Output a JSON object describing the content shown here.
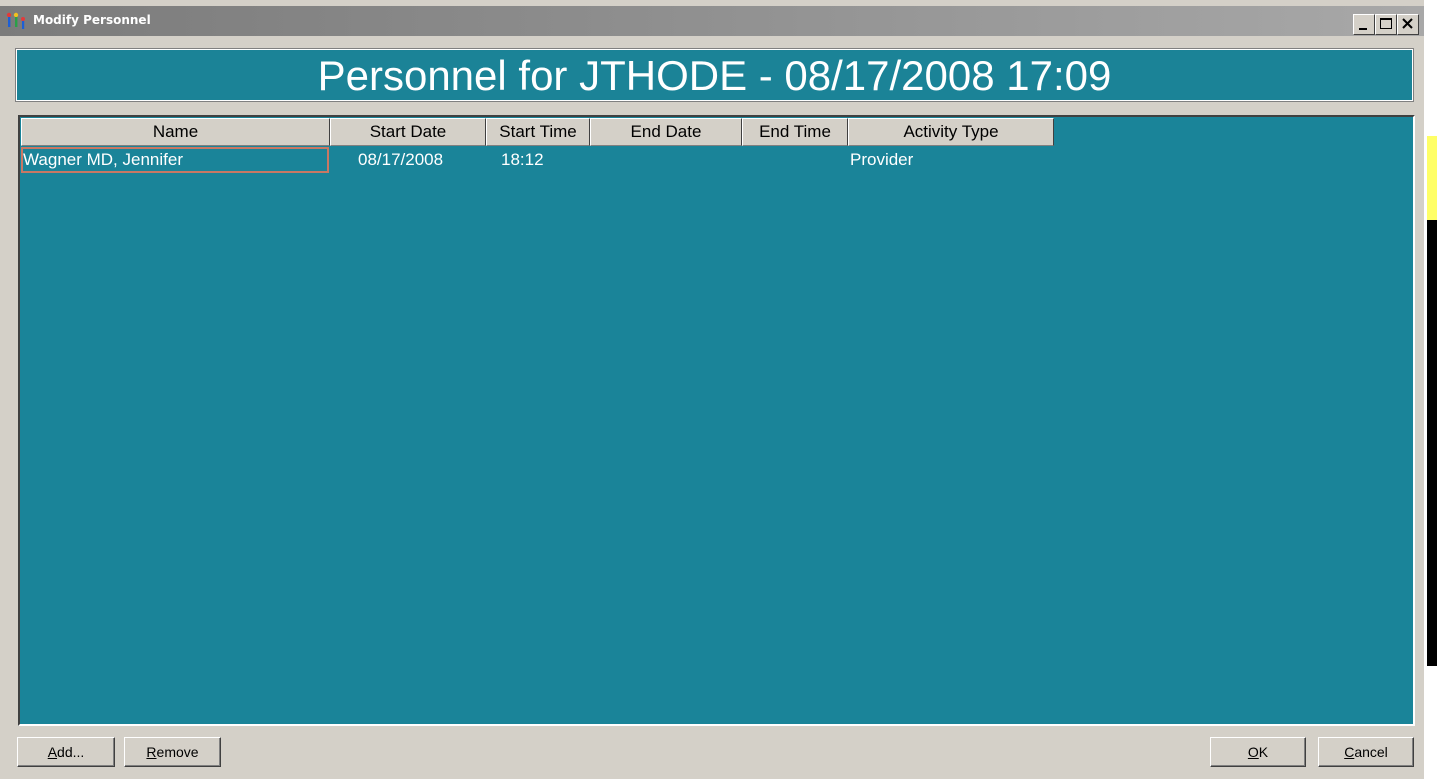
{
  "window": {
    "title": "Modify Personnel",
    "icon": "people-app-icon",
    "controls": [
      "minimize-icon",
      "maximize-icon",
      "close-icon"
    ]
  },
  "banner": {
    "text": "Personnel for JTHODE - 08/17/2008 17:09"
  },
  "table": {
    "columns": [
      "Name",
      "Start Date",
      "Start Time",
      "End Date",
      "End Time",
      "Activity Type"
    ],
    "rows": [
      {
        "name": "Wagner  MD, Jennifer",
        "start_date": "08/17/2008",
        "start_time": "18:12",
        "end_date": "",
        "end_time": "",
        "activity_type": "Provider"
      }
    ]
  },
  "buttons": {
    "add": {
      "accel": "A",
      "rest": "dd..."
    },
    "remove": {
      "accel": "R",
      "rest": "emove"
    },
    "ok": {
      "accel": "O",
      "rest": "K"
    },
    "cancel": {
      "accel": "C",
      "rest": "ancel"
    }
  },
  "colors": {
    "banner_bg": "#1b8397",
    "list_bg": "#1a8499",
    "dialog_bg": "#d4d0c8",
    "selection_border": "#c87864"
  }
}
